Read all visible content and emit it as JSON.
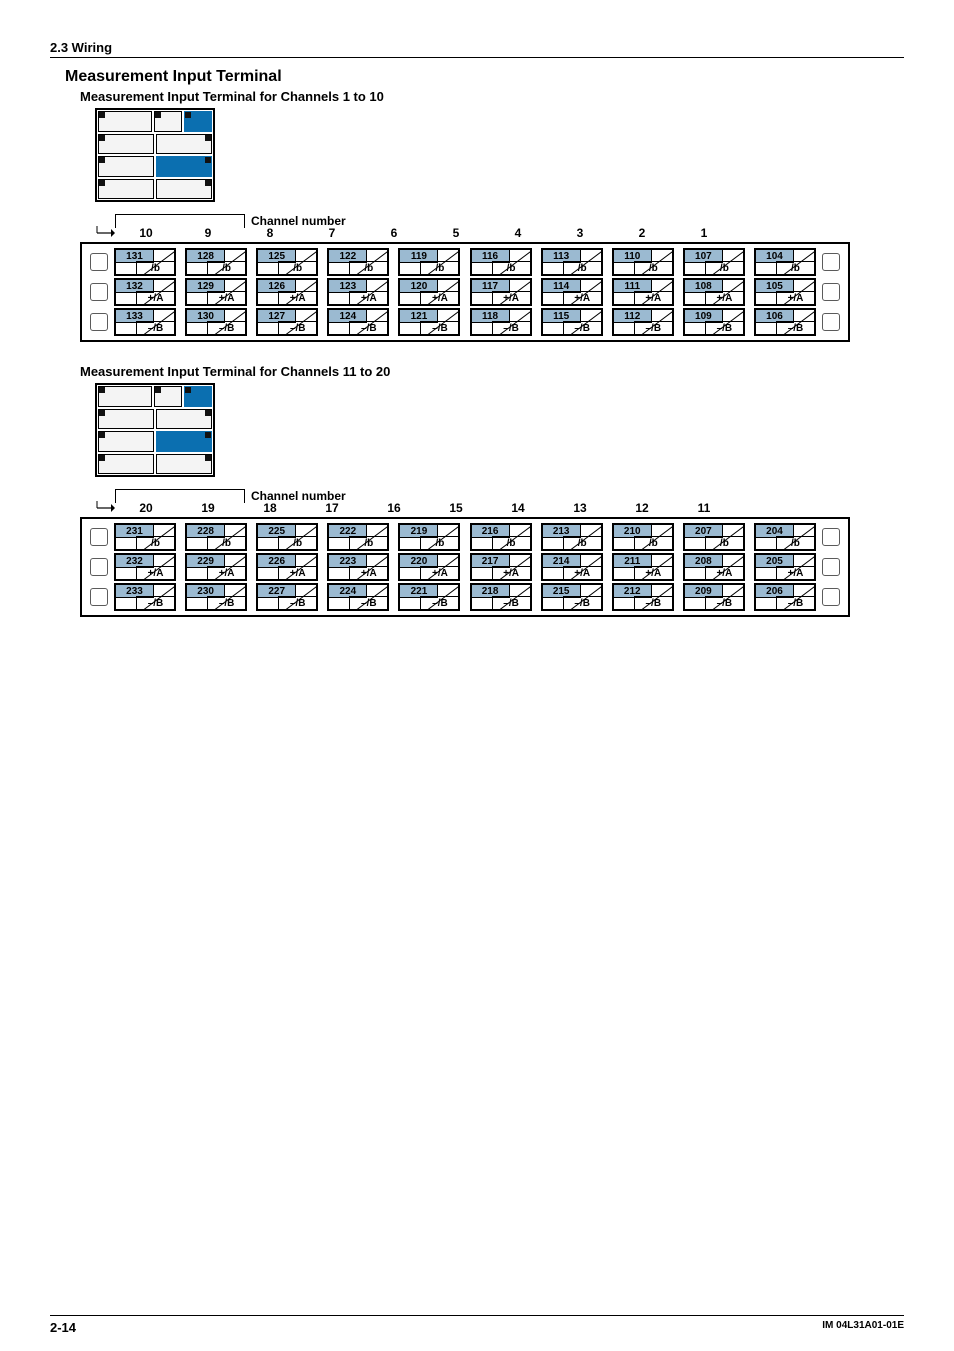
{
  "doc": {
    "section_header": "2.3  Wiring",
    "page_num": "2-14",
    "doc_id": "IM 04L31A01-01E"
  },
  "main_title": "Measurement Input Terminal",
  "groups": [
    {
      "subtitle": "Measurement Input Terminal for Channels 1 to 10",
      "ch_label": "Channel number",
      "headers": [
        "10",
        "9",
        "8",
        "7",
        "6",
        "5",
        "4",
        "3",
        "2",
        "1"
      ],
      "rows": [
        {
          "sub": "/b",
          "nums": [
            "131",
            "128",
            "125",
            "122",
            "119",
            "116",
            "113",
            "110",
            "107",
            "104"
          ]
        },
        {
          "sub": "+/A",
          "nums": [
            "132",
            "129",
            "126",
            "123",
            "120",
            "117",
            "114",
            "111",
            "108",
            "105"
          ]
        },
        {
          "sub": "–/B",
          "nums": [
            "133",
            "130",
            "127",
            "124",
            "121",
            "118",
            "115",
            "112",
            "109",
            "106"
          ]
        }
      ]
    },
    {
      "subtitle": "Measurement Input Terminal for Channels 11 to 20",
      "ch_label": "Channel number",
      "headers": [
        "20",
        "19",
        "18",
        "17",
        "16",
        "15",
        "14",
        "13",
        "12",
        "11"
      ],
      "rows": [
        {
          "sub": "/b",
          "nums": [
            "231",
            "228",
            "225",
            "222",
            "219",
            "216",
            "213",
            "210",
            "207",
            "204"
          ]
        },
        {
          "sub": "+/A",
          "nums": [
            "232",
            "229",
            "226",
            "223",
            "220",
            "217",
            "214",
            "211",
            "208",
            "205"
          ]
        },
        {
          "sub": "–/B",
          "nums": [
            "233",
            "230",
            "227",
            "224",
            "221",
            "218",
            "215",
            "212",
            "209",
            "206"
          ]
        }
      ]
    }
  ]
}
